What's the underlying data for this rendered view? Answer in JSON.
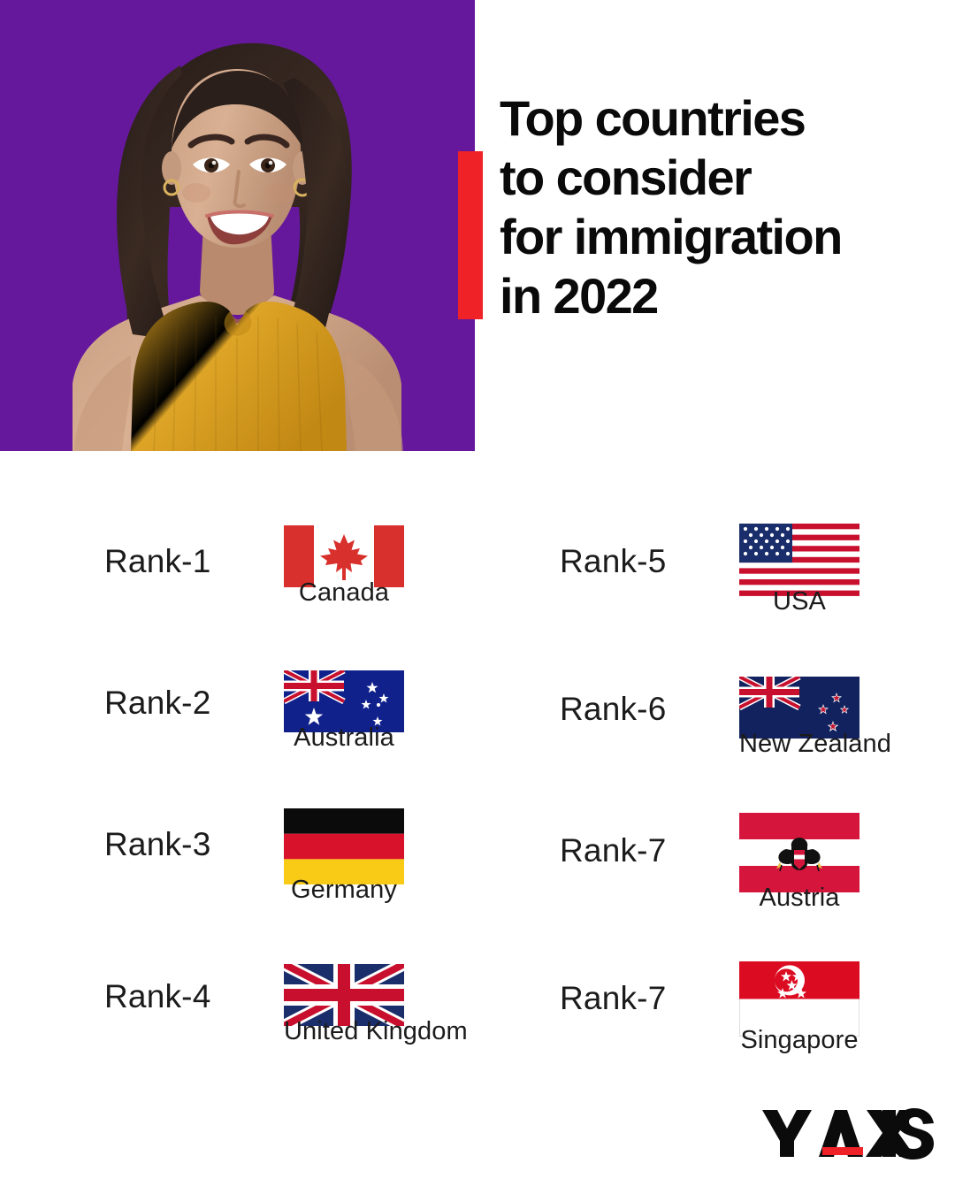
{
  "colors": {
    "purple": "#65189C",
    "accent_red": "#EE2227",
    "text": "#1b1b1b",
    "headline": "#0a0a0a"
  },
  "hero": {
    "portrait_alt": "smiling-woman-portrait",
    "headline_lines": [
      "Top countries",
      "to consider",
      "for immigration",
      "in 2022"
    ]
  },
  "ranks": {
    "left_column": [
      {
        "rank_label": "Rank-1",
        "country": "Canada",
        "flag": "canada-flag"
      },
      {
        "rank_label": "Rank-2",
        "country": "Australia",
        "flag": "australia-flag"
      },
      {
        "rank_label": "Rank-3",
        "country": "Germany",
        "flag": "germany-flag"
      },
      {
        "rank_label": "Rank-4",
        "country": "United Kingdom",
        "flag": "united-kingdom-flag"
      }
    ],
    "right_column": [
      {
        "rank_label": "Rank-5",
        "country": "USA",
        "flag": "usa-flag"
      },
      {
        "rank_label": "Rank-6",
        "country": "New Zealand",
        "flag": "new-zealand-flag"
      },
      {
        "rank_label": "Rank-7",
        "country": "Austria",
        "flag": "austria-flag"
      },
      {
        "rank_label": "Rank-7",
        "country": "Singapore",
        "flag": "singapore-flag"
      }
    ]
  },
  "logo": {
    "text_y": "Y",
    "text_axis": "AXIS",
    "full": "Y AXIS"
  }
}
